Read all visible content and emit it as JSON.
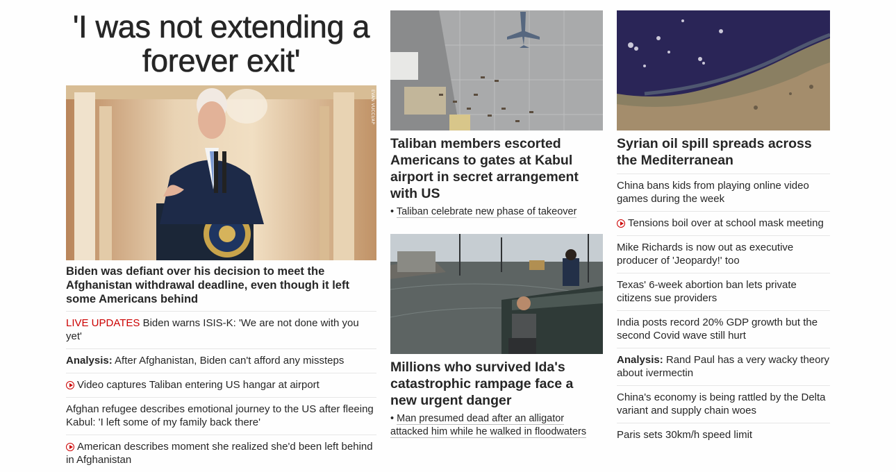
{
  "lead": {
    "title": "'I was not extending a forever exit'",
    "photo_credit": "EVAN VUCCI/AP",
    "summary": "Biden was defiant over his decision to meet the Afghanistan withdrawal deadline, even though it left some Americans behind",
    "links": [
      {
        "tag": "LIVE UPDATES",
        "text": "Biden warns ISIS-K: 'We are not done with you yet'",
        "type": "live"
      },
      {
        "tag": "Analysis:",
        "text": "After Afghanistan, Biden can't afford any missteps",
        "type": "analysis"
      },
      {
        "text": "Video captures Taliban entering US hangar at airport",
        "type": "video"
      },
      {
        "text": "Afghan refugee describes emotional journey to the US after fleeing Kabul: 'I left some of my family back there'",
        "type": "text"
      },
      {
        "text": "American describes moment she realized she'd been left behind in Afghanistan",
        "type": "video"
      }
    ]
  },
  "story2": {
    "headline": "Taliban members escorted Americans to gates at Kabul airport in secret arrangement with US",
    "sub": "Taliban celebrate new phase of takeover"
  },
  "story3": {
    "headline": "Millions who survived Ida's catastrophic rampage face a new urgent danger",
    "sub": "Man presumed dead after an alligator attacked him while he walked in floodwaters"
  },
  "story4": {
    "headline": "Syrian oil spill spreads across the Mediterranean",
    "links": [
      {
        "text": "China bans kids from playing online video games during the week",
        "type": "text"
      },
      {
        "text": "Tensions boil over at school mask meeting",
        "type": "video"
      },
      {
        "text": "Mike Richards is now out as executive producer of 'Jeopardy!' too",
        "type": "text"
      },
      {
        "text": "Texas' 6-week abortion ban lets private citizens sue providers",
        "type": "text"
      },
      {
        "text": "India posts record 20% GDP growth but the second Covid wave still hurt",
        "type": "text"
      },
      {
        "tag": "Analysis:",
        "text": "Rand Paul has a very wacky theory about ivermectin",
        "type": "analysis"
      },
      {
        "text": "China's economy is being rattled by the Delta variant and supply chain woes",
        "type": "text"
      },
      {
        "text": "Paris sets 30km/h speed limit",
        "type": "text"
      }
    ]
  },
  "colors": {
    "live": "#cc0000",
    "text": "#262626",
    "divider": "#e6e6e6"
  }
}
